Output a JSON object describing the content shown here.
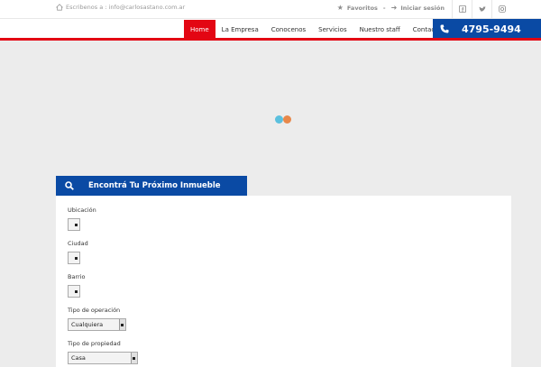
{
  "topbar": {
    "contact_text": "Escribenos a : info@carlosastano.com.ar",
    "favorites": "Favoritos",
    "separator": "-",
    "login": "Iniciar sesión",
    "social": [
      "facebook-icon",
      "twitter-icon",
      "instagram-icon"
    ]
  },
  "nav": {
    "items": [
      "Home",
      "La Empresa",
      "Conocenos",
      "Servicios",
      "Nuestro staff",
      "Contacto"
    ],
    "active": "Home",
    "phone": "4795-9494"
  },
  "colors": {
    "brand_red": "#e30613",
    "brand_blue": "#0a4aa4",
    "loader_blue": "#5bc0de",
    "loader_orange": "#e8884a"
  },
  "search": {
    "title": "Encontrá Tu Próximo Inmueble",
    "fields": [
      {
        "label": "Ubicación",
        "value": ""
      },
      {
        "label": "Ciudad",
        "value": ""
      },
      {
        "label": "Barrio",
        "value": ""
      },
      {
        "label": "Tipo de operación",
        "value": "Cualquiera"
      },
      {
        "label": "Tipo de propiedad",
        "value": "Casa"
      }
    ]
  }
}
